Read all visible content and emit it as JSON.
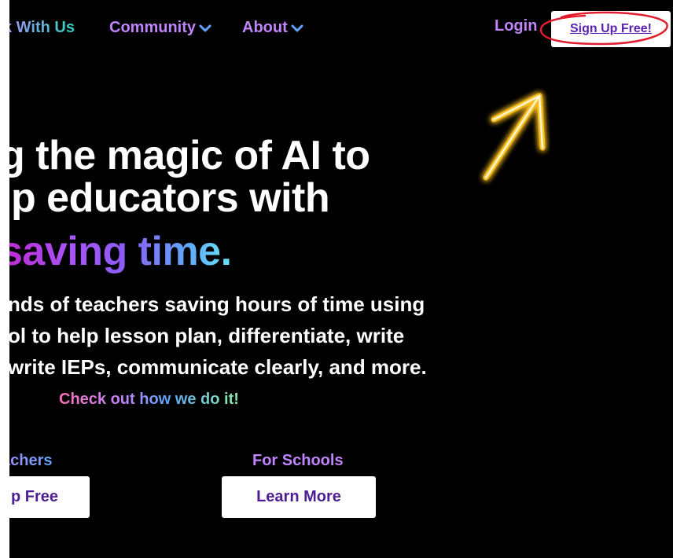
{
  "nav": {
    "work_with_us": "k With Us",
    "community": "Community",
    "about": "About",
    "login": "Login",
    "signup": "Sign Up Free!"
  },
  "hero": {
    "line1": "g the magic of AI to",
    "line2": "lp educators with",
    "line3": "saving time.",
    "para1": "nds of teachers saving hours of time using",
    "para2": "ol to help lesson plan, differentiate, write",
    "para3": "write IEPs, communicate clearly, and more.",
    "check_out": "Check out how we do it!"
  },
  "cta": {
    "teachers_label": "achers",
    "teachers_button": "p Free",
    "schools_label": "For Schools",
    "schools_button": "Learn More"
  },
  "icons": {
    "community_chevron": "chevron-down-icon",
    "about_chevron": "chevron-down-icon",
    "annotation_arrow": "arrow-up-right-icon"
  },
  "colors": {
    "background": "#000000",
    "nav_purple": "#c084fc",
    "button_text": "#4c1d95",
    "annotation_red": "#e11d2e",
    "annotation_glow": "#fbbf24"
  }
}
